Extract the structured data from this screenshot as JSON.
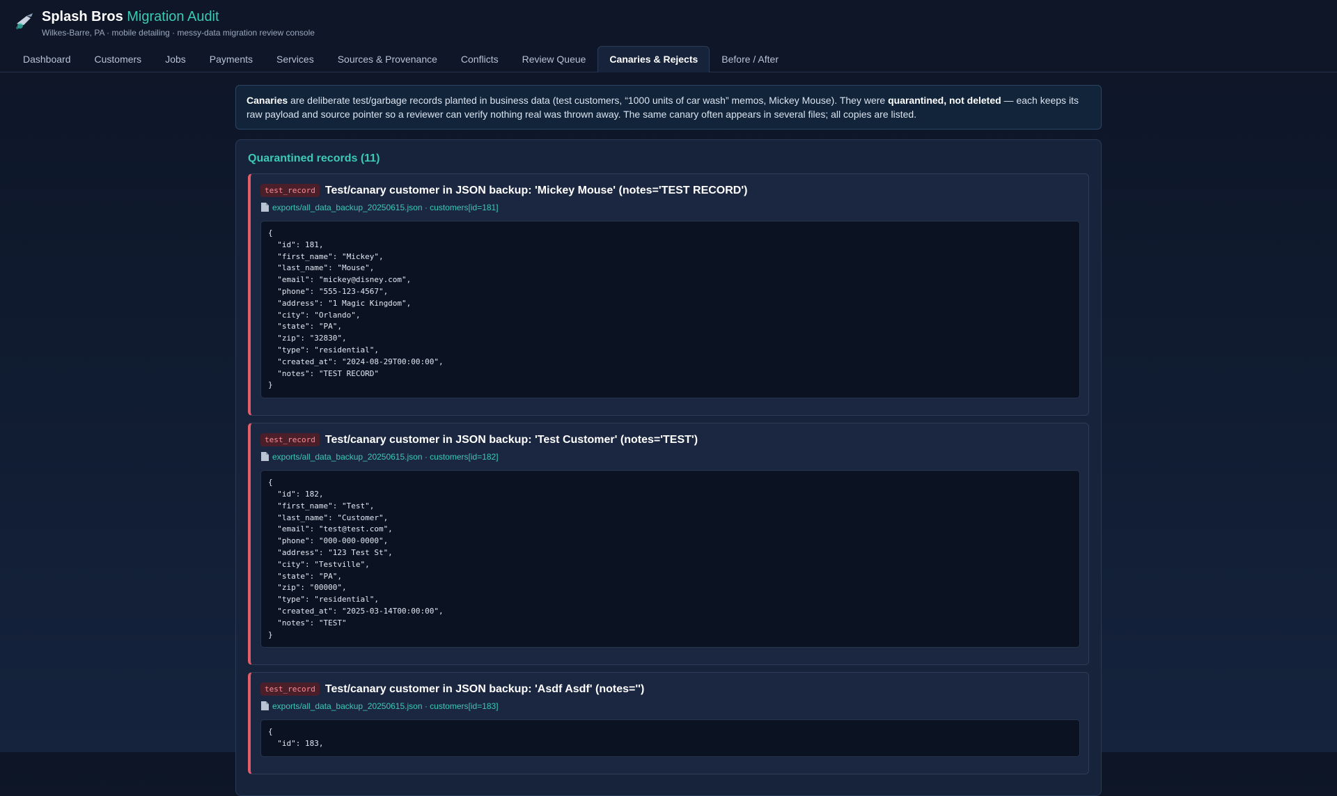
{
  "app": {
    "title_main": "Splash Bros",
    "title_accent": "Migration Audit",
    "subtitle": "Wilkes-Barre, PA · mobile detailing · messy-data migration review console"
  },
  "tabs": [
    {
      "label": "Dashboard"
    },
    {
      "label": "Customers"
    },
    {
      "label": "Jobs"
    },
    {
      "label": "Payments"
    },
    {
      "label": "Services"
    },
    {
      "label": "Sources & Provenance"
    },
    {
      "label": "Conflicts"
    },
    {
      "label": "Review Queue"
    },
    {
      "label": "Canaries & Rejects",
      "active": true
    },
    {
      "label": "Before / After"
    }
  ],
  "info": {
    "term": "Canaries",
    "text1": " are deliberate test/garbage records planted in business data (test customers, “1000 units of car wash” memos, Mickey Mouse). They were ",
    "emph": "quarantined, not deleted",
    "text2": " — each keeps its raw payload and source pointer so a reviewer can verify nothing real was thrown away. The same canary often appears in several files; all copies are listed."
  },
  "panel": {
    "title": "Quarantined records (11)"
  },
  "records": [
    {
      "badge": "test_record",
      "title": "Test/canary customer in JSON backup: 'Mickey Mouse' (notes='TEST RECORD')",
      "source": "exports/all_data_backup_20250615.json · customers[id=181]",
      "payload": "{\n  \"id\": 181,\n  \"first_name\": \"Mickey\",\n  \"last_name\": \"Mouse\",\n  \"email\": \"mickey@disney.com\",\n  \"phone\": \"555-123-4567\",\n  \"address\": \"1 Magic Kingdom\",\n  \"city\": \"Orlando\",\n  \"state\": \"PA\",\n  \"zip\": \"32830\",\n  \"type\": \"residential\",\n  \"created_at\": \"2024-08-29T00:00:00\",\n  \"notes\": \"TEST RECORD\"\n}"
    },
    {
      "badge": "test_record",
      "title": "Test/canary customer in JSON backup: 'Test Customer' (notes='TEST')",
      "source": "exports/all_data_backup_20250615.json · customers[id=182]",
      "payload": "{\n  \"id\": 182,\n  \"first_name\": \"Test\",\n  \"last_name\": \"Customer\",\n  \"email\": \"test@test.com\",\n  \"phone\": \"000-000-0000\",\n  \"address\": \"123 Test St\",\n  \"city\": \"Testville\",\n  \"state\": \"PA\",\n  \"zip\": \"00000\",\n  \"type\": \"residential\",\n  \"created_at\": \"2025-03-14T00:00:00\",\n  \"notes\": \"TEST\"\n}"
    },
    {
      "badge": "test_record",
      "title": "Test/canary customer in JSON backup: 'Asdf Asdf' (notes='')",
      "source": "exports/all_data_backup_20250615.json · customers[id=183]",
      "payload": "{\n  \"id\": 183,"
    }
  ]
}
